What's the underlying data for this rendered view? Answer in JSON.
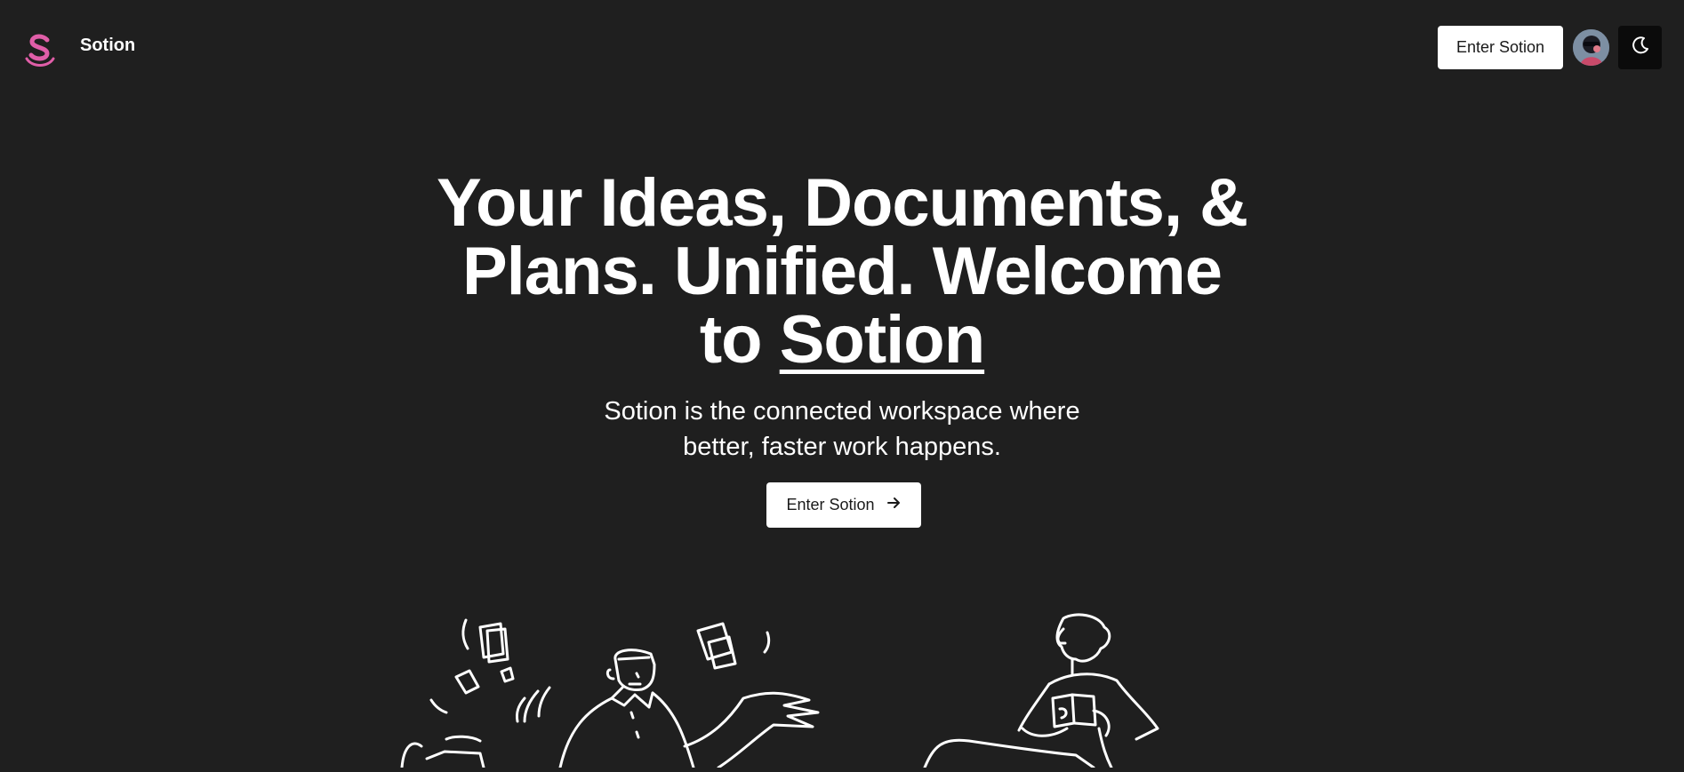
{
  "header": {
    "brand": "Sotion",
    "enter_label": "Enter Sotion",
    "logo_icon": "sotion-logo-icon",
    "avatar_icon": "user-avatar",
    "theme_icon": "moon-icon"
  },
  "hero": {
    "title_line1": "Your Ideas, Documents, &",
    "title_line2": "Plans. Unified. Welcome",
    "title_to": "to",
    "title_accent": "Sotion",
    "subtitle_line1": "Sotion is the connected workspace where",
    "subtitle_line2": "better, faster work happens.",
    "cta_label": "Enter Sotion",
    "cta_icon": "arrow-right-icon"
  },
  "colors": {
    "background": "#1f1f1f",
    "logo_pink": "#e05ea8",
    "button_bg": "#ffffff",
    "toggle_bg": "#0b0b0b"
  }
}
